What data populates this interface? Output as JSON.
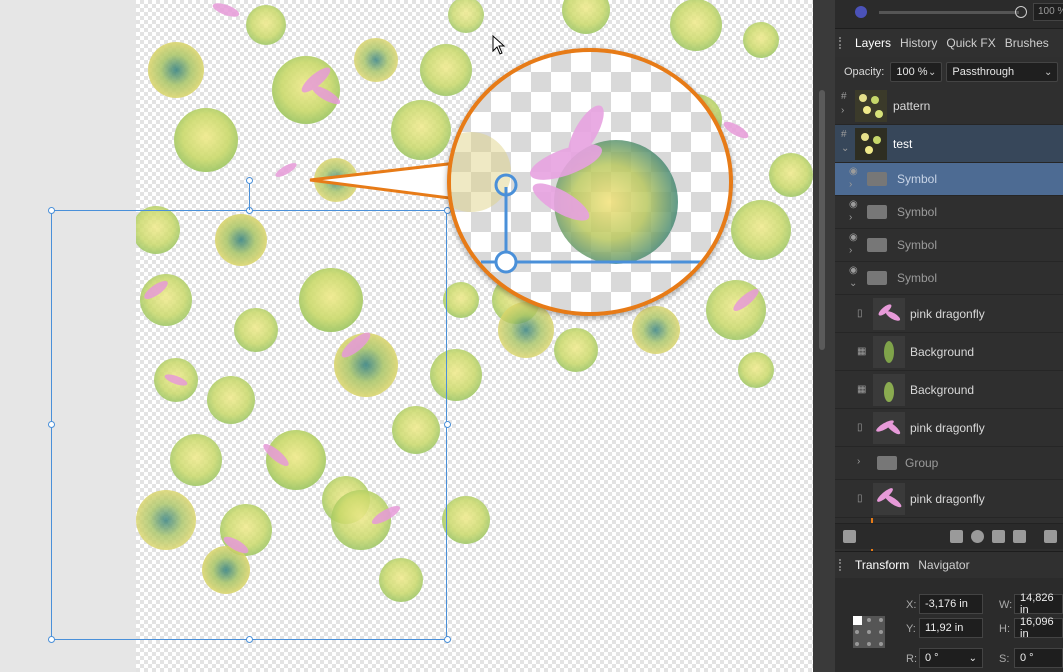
{
  "layers_panel": {
    "tabs": [
      "Layers",
      "History",
      "Quick FX",
      "Brushes"
    ],
    "opacity_label": "Opacity:",
    "opacity_value": "100 %",
    "blend_mode": "Passthrough",
    "top_slider_value": "100 %",
    "layers": [
      {
        "name": "pattern",
        "state": "normal"
      },
      {
        "name": "test",
        "state": "selected"
      },
      {
        "name": "Symbol",
        "state": "highlighted"
      },
      {
        "name": "Symbol",
        "state": "normal"
      },
      {
        "name": "Symbol",
        "state": "normal"
      },
      {
        "name": "Symbol",
        "state": "normal"
      },
      {
        "name": "pink dragonfly",
        "state": "normal"
      },
      {
        "name": "Background",
        "state": "normal"
      },
      {
        "name": "Background",
        "state": "normal"
      },
      {
        "name": "pink dragonfly",
        "state": "normal"
      },
      {
        "name": "Group",
        "state": "normal"
      },
      {
        "name": "pink dragonfly",
        "state": "normal"
      }
    ]
  },
  "transform_panel": {
    "tabs": [
      "Transform",
      "Navigator"
    ],
    "x_label": "X:",
    "x_value": "-3,176 in",
    "y_label": "Y:",
    "y_value": "11,92 in",
    "w_label": "W:",
    "w_value": "14,826 in",
    "h_label": "H:",
    "h_value": "16,096 in",
    "r_label": "R:",
    "r_value": "0 °",
    "s_label": "S:",
    "s_value": "0 °"
  },
  "colors": {
    "accent": "#e77b17",
    "selection": "#4a90d9",
    "panel_bg": "#2f2f2f"
  },
  "icons": [
    "layer-group-icon",
    "visibility-icon",
    "expand-chevron-icon",
    "folder-icon",
    "mask-icon",
    "adjustment-icon",
    "fx-icon",
    "add-layer-icon"
  ]
}
